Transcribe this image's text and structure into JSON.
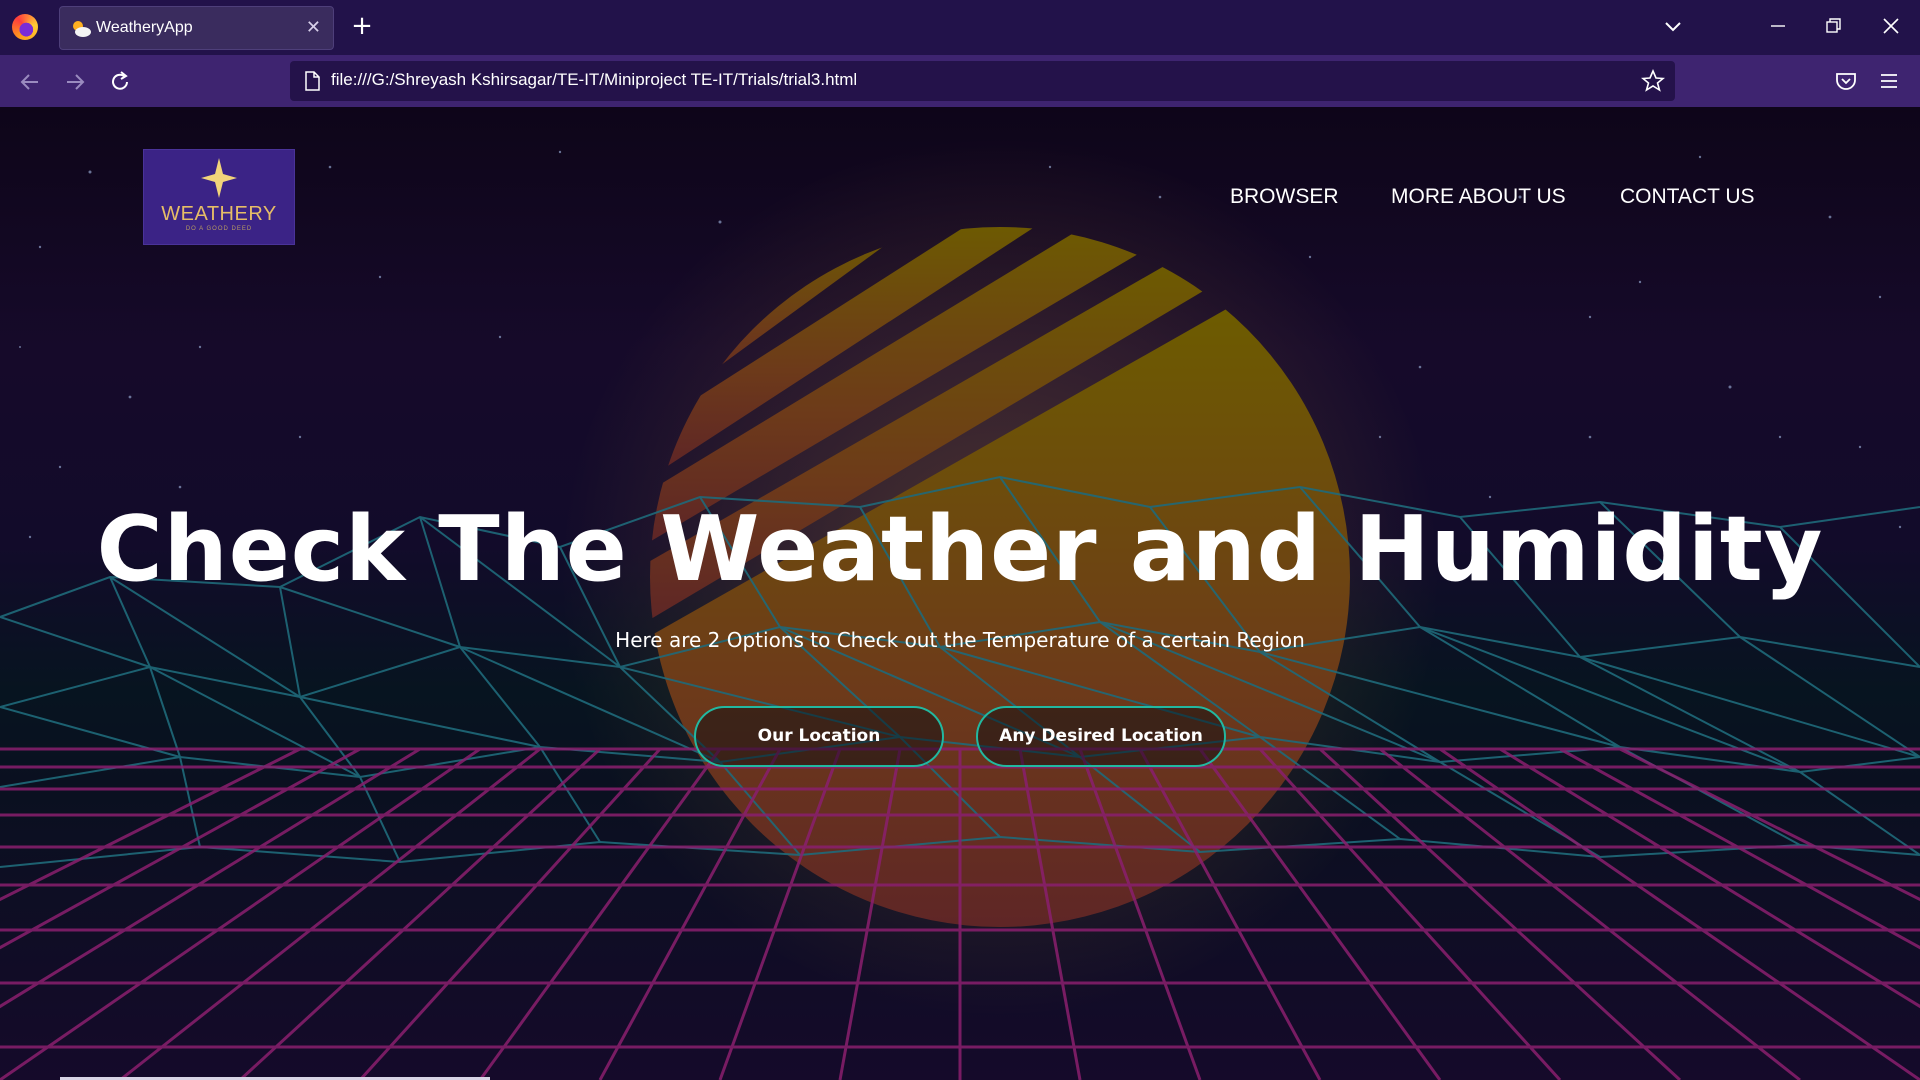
{
  "browser": {
    "tab_title": "WeatheryApp",
    "url": "file:///G:/Shreyash Kshirsagar/TE-IT/Miniproject TE-IT/Trials/trial3.html",
    "icons": [
      "firefox-icon",
      "tab-favicon-weather-icon",
      "close-icon",
      "plus-icon",
      "chevron-down-icon",
      "minimize-icon",
      "restore-icon",
      "close-window-icon",
      "back-arrow-icon",
      "forward-arrow-icon",
      "reload-icon",
      "page-icon",
      "bookmark-star-icon",
      "pocket-icon",
      "hamburger-menu-icon"
    ]
  },
  "site": {
    "logo": {
      "text": "WEATHERY",
      "tagline": "DO A GOOD DEED",
      "colors": {
        "background": "#3b2386",
        "text": "#e6bd67"
      }
    },
    "nav": [
      {
        "label": "BROWSER"
      },
      {
        "label": "MORE ABOUT US"
      },
      {
        "label": "CONTACT US"
      }
    ]
  },
  "hero": {
    "title": "Check The Weather and Humidity",
    "subtitle": "Here are 2 Options to Check out the Temperature of a certain Region",
    "buttons": [
      {
        "label": "Our Location"
      },
      {
        "label": "Any Desired Location"
      }
    ],
    "colors": {
      "button_border": "#22b8a0",
      "grid": "#8a1f6e",
      "mesh": "#1f6a7a",
      "sun": "#c9a020"
    }
  }
}
